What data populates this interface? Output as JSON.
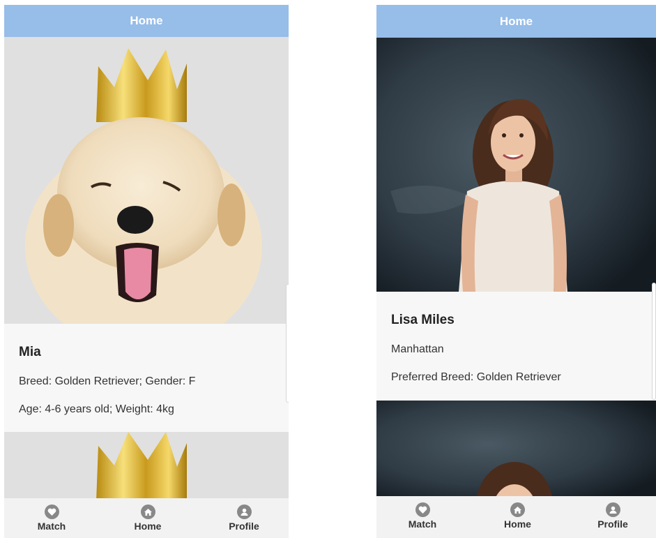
{
  "left": {
    "header_title": "Home",
    "card": {
      "name": "Mia",
      "line1": "Breed: Golden Retriever; Gender: F",
      "line2": "Age: 4-6 years old; Weight: 4kg"
    },
    "tabs": [
      {
        "label": "Match",
        "icon": "heart-icon"
      },
      {
        "label": "Home",
        "icon": "home-icon"
      },
      {
        "label": "Profile",
        "icon": "user-icon"
      }
    ]
  },
  "right": {
    "header_title": "Home",
    "card": {
      "name": "Lisa Miles",
      "line1": "Manhattan",
      "line2": "Preferred Breed: Golden Retriever"
    },
    "tabs": [
      {
        "label": "Match",
        "icon": "heart-icon"
      },
      {
        "label": "Home",
        "icon": "home-icon"
      },
      {
        "label": "Profile",
        "icon": "user-icon"
      }
    ]
  },
  "colors": {
    "header": "#97bde9",
    "card_bg": "#f7f7f7",
    "tabbar_bg": "#f2f2f2"
  }
}
